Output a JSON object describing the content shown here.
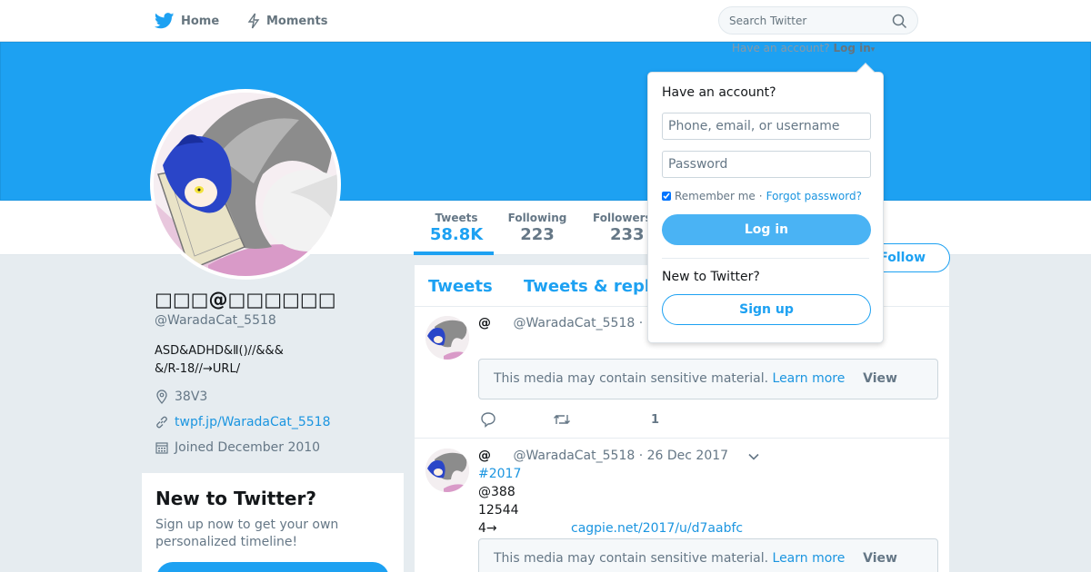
{
  "nav": {
    "home_label": "Home",
    "moments_label": "Moments",
    "search_placeholder": "Search Twitter"
  },
  "login_trigger": {
    "prompt": "Have an account?",
    "label": "Log in"
  },
  "stats": {
    "tweets_label": "Tweets",
    "tweets_value": "58.8K",
    "following_label": "Following",
    "following_value": "223",
    "followers_label": "Followers",
    "followers_value": "233"
  },
  "follow_label": "Follow",
  "profile": {
    "name": "□□□@□□□□□□",
    "handle": "@WaradaCat_5518",
    "bio_line1": "ASD&ADHD&Ⅱ()//&&&",
    "bio_line2": "&/R-18//→URL/",
    "location": "38V3",
    "link": "twpf.jp/WaradaCat_5518",
    "joined": "Joined December 2010"
  },
  "new_card": {
    "title": "New to Twitter?",
    "text": "Sign up now to get your own personalized timeline!"
  },
  "timeline": {
    "tabs": [
      "Tweets",
      "Tweets & repl"
    ],
    "tweets": [
      {
        "at": "@",
        "handle": "@WaradaCat_5518",
        "sep": "·",
        "sensitive_text": "This media may contain sensitive material.",
        "learn_more": "Learn more",
        "view": "View",
        "like_count": "1"
      },
      {
        "at": "@",
        "handle": "@WaradaCat_5518",
        "date": "· 26 Dec 2017",
        "hashtag": "#2017",
        "line2": "@388",
        "line3": "12544",
        "line4": "4→",
        "url": "cagpie.net/2017/u/d7aabfc",
        "sensitive_text": "This media may contain sensitive material.",
        "learn_more": "Learn more",
        "view": "View"
      }
    ]
  },
  "login_dropdown": {
    "title": "Have an account?",
    "username_placeholder": "Phone, email, or username",
    "password_placeholder": "Password",
    "remember_label": "Remember me",
    "separator": "·",
    "forgot_label": "Forgot password?",
    "login_button": "Log in",
    "new_label": "New to Twitter?",
    "signup_button": "Sign up"
  },
  "colors": {
    "accent": "#1da1f2",
    "link": "#1b95e0",
    "muted": "#657786",
    "background": "#e6ecf0"
  }
}
